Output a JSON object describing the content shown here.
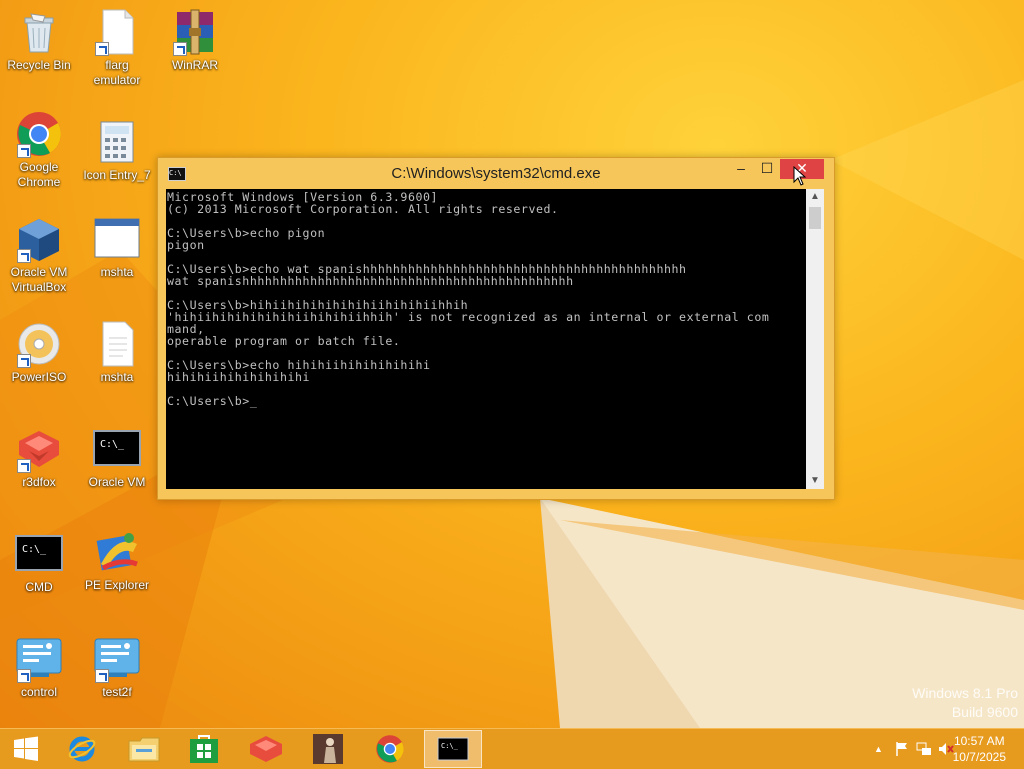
{
  "desktop": {
    "icons": [
      {
        "label": "Recycle Bin",
        "icon": "recycle-bin-icon"
      },
      {
        "label": "flarg\nemulator",
        "icon": "file-icon"
      },
      {
        "label": "WinRAR",
        "icon": "winrar-icon"
      },
      {
        "label": "Google\nChrome",
        "icon": "chrome-icon"
      },
      {
        "label": "Icon Entry_7",
        "icon": "calculator-icon"
      },
      {
        "label": "Oracle VM\nVirtualBox",
        "icon": "virtualbox-icon"
      },
      {
        "label": "mshta",
        "icon": "window-icon"
      },
      {
        "label": "PowerISO",
        "icon": "disc-icon"
      },
      {
        "label": "mshta",
        "icon": "text-file-icon"
      },
      {
        "label": "r3dfox",
        "icon": "r3dfox-icon"
      },
      {
        "label": "Oracle VM",
        "icon": "console-icon"
      },
      {
        "label": "CMD",
        "icon": "console-icon"
      },
      {
        "label": "PE Explorer",
        "icon": "pe-explorer-icon"
      },
      {
        "label": "control",
        "icon": "control-panel-icon"
      },
      {
        "label": "test2f",
        "icon": "control-panel-icon"
      }
    ],
    "watermark_line1": "Windows 8.1 Pro",
    "watermark_line2": "Build 9600"
  },
  "cmd_window": {
    "title": "C:\\Windows\\system32\\cmd.exe",
    "icon_text": "C:\\",
    "buttons": {
      "minimize": "–",
      "maximize": "☐",
      "close": "✕"
    },
    "console_text": "Microsoft Windows [Version 6.3.9600]\n(c) 2013 Microsoft Corporation. All rights reserved.\n\nC:\\Users\\b>echo pigon\npigon\n\nC:\\Users\\b>echo wat spanishhhhhhhhhhhhhhhhhhhhhhhhhhhhhhhhhhhhhhhhhhh\nwat spanishhhhhhhhhhhhhhhhhhhhhhhhhhhhhhhhhhhhhhhhhhhh\n\nC:\\Users\\b>hihiihihihihihihiihihihiihhih\n'hihiihihihihihihiihihihiihhih' is not recognized as an internal or external com\nmand,\noperable program or batch file.\n\nC:\\Users\\b>echo hihihiihihihihihihi\nhihihiihihihihihihi\n\nC:\\Users\\b>_",
    "scroll_up": "▲",
    "scroll_down": "▼"
  },
  "taskbar": {
    "items": [
      {
        "name": "start-button",
        "icon": "windows-logo-icon"
      },
      {
        "name": "internet-explorer",
        "icon": "internet-explorer-icon"
      },
      {
        "name": "file-explorer",
        "icon": "folder-icon"
      },
      {
        "name": "store",
        "icon": "store-icon"
      },
      {
        "name": "r3dfox",
        "icon": "r3dfox-icon"
      },
      {
        "name": "app-figure",
        "icon": "figure-icon"
      },
      {
        "name": "chrome",
        "icon": "chrome-icon"
      },
      {
        "name": "cmd",
        "icon": "console-icon",
        "active": true
      }
    ],
    "tray": {
      "chevron": "▲",
      "time": "10:57 AM",
      "date": "10/7/2025"
    }
  }
}
